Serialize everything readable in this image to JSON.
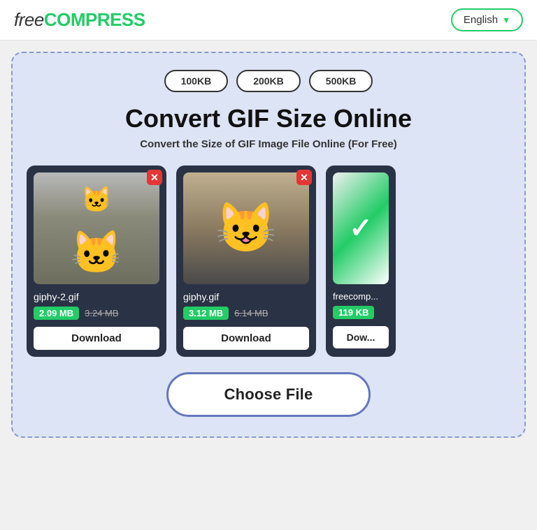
{
  "header": {
    "logo_free": "free",
    "logo_compress": "COMPRESS",
    "lang_label": "English",
    "lang_chevron": "▼"
  },
  "main": {
    "size_buttons": [
      "100KB",
      "200KB",
      "500KB"
    ],
    "title": "Convert GIF Size Online",
    "subtitle": "Convert the Size of GIF Image File Online (For Free)",
    "cards": [
      {
        "filename": "giphy-2.gif",
        "size_new": "2.09 MB",
        "size_old": "3.24 MB",
        "download_label": "Download"
      },
      {
        "filename": "giphy.gif",
        "size_new": "3.12 MB",
        "size_old": "6.14 MB",
        "download_label": "Download"
      },
      {
        "filename": "freecomp...",
        "size_new": "119 KB",
        "size_old": "",
        "download_label": "Dow..."
      }
    ],
    "choose_file_label": "Choose File"
  }
}
